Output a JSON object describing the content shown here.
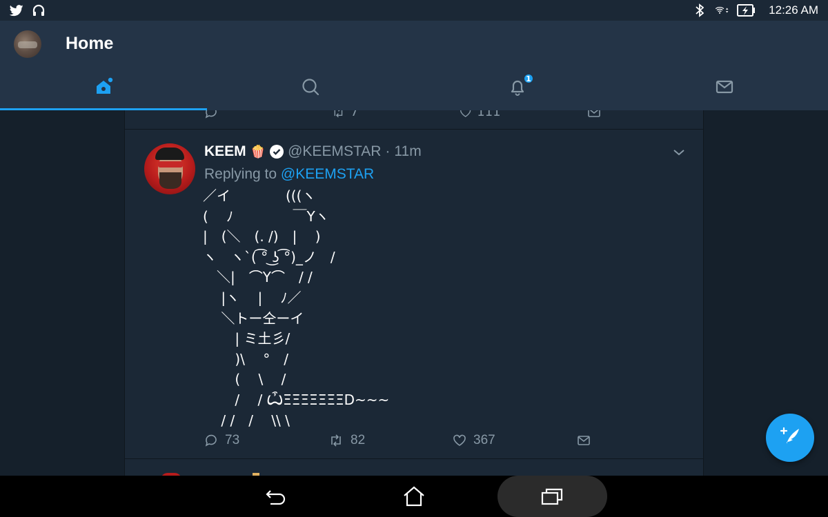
{
  "status_bar": {
    "left_icons": [
      "twitter-icon",
      "headset-icon"
    ],
    "right_icons": [
      "bluetooth-icon",
      "wifi-icon",
      "battery-charging-icon"
    ],
    "time": "12:26 AM"
  },
  "header": {
    "title": "Home"
  },
  "tabs": [
    {
      "name": "home",
      "icon": "home-icon",
      "active": true
    },
    {
      "name": "search",
      "icon": "search-icon",
      "active": false
    },
    {
      "name": "notifications",
      "icon": "bell-icon",
      "badge": "1",
      "active": false
    },
    {
      "name": "messages",
      "icon": "mail-icon",
      "active": false
    }
  ],
  "previous_tweet": {
    "retweets": "7",
    "likes": "111"
  },
  "tweet": {
    "display_name": "KEEM",
    "emoji": "🍿",
    "handle": "@KEEMSTAR",
    "separator": "·",
    "time": "11m",
    "replying_prefix": "Replying to",
    "replying_to": "@KEEMSTAR",
    "ascii_art": [
      "／イ　　　　(((ヽ",
      "(　 ﾉ　　　　 ￣Yヽ",
      "|　(＼　(. /)　|　 )",
      "ヽ　ヽ`( ͡° ͜ʖ ͡°)_ノ　/",
      "　＼|　⌒Y⌒　/ /",
      "　 |ヽ　 |　 ﾉ／",
      "　 ＼トー仝ーイ",
      "　　 | ミ土彡/",
      "　　 )\\　 °　/",
      "　　 (　 \\　 /",
      "　　 /　 / ѼΞΞΞΞΞΞΞD~~~",
      "　 / /　/　 \\\\ \\"
    ],
    "replies": "73",
    "retweets": "82",
    "likes": "367"
  },
  "fab": {
    "icon": "compose-tweet-icon"
  },
  "nav_bar": {
    "icons": [
      "back-icon",
      "home-nav-icon",
      "recents-icon"
    ]
  },
  "colors": {
    "accent": "#1da1f2",
    "background": "#15202b",
    "header": "#243447",
    "muted_text": "#8899a6"
  }
}
